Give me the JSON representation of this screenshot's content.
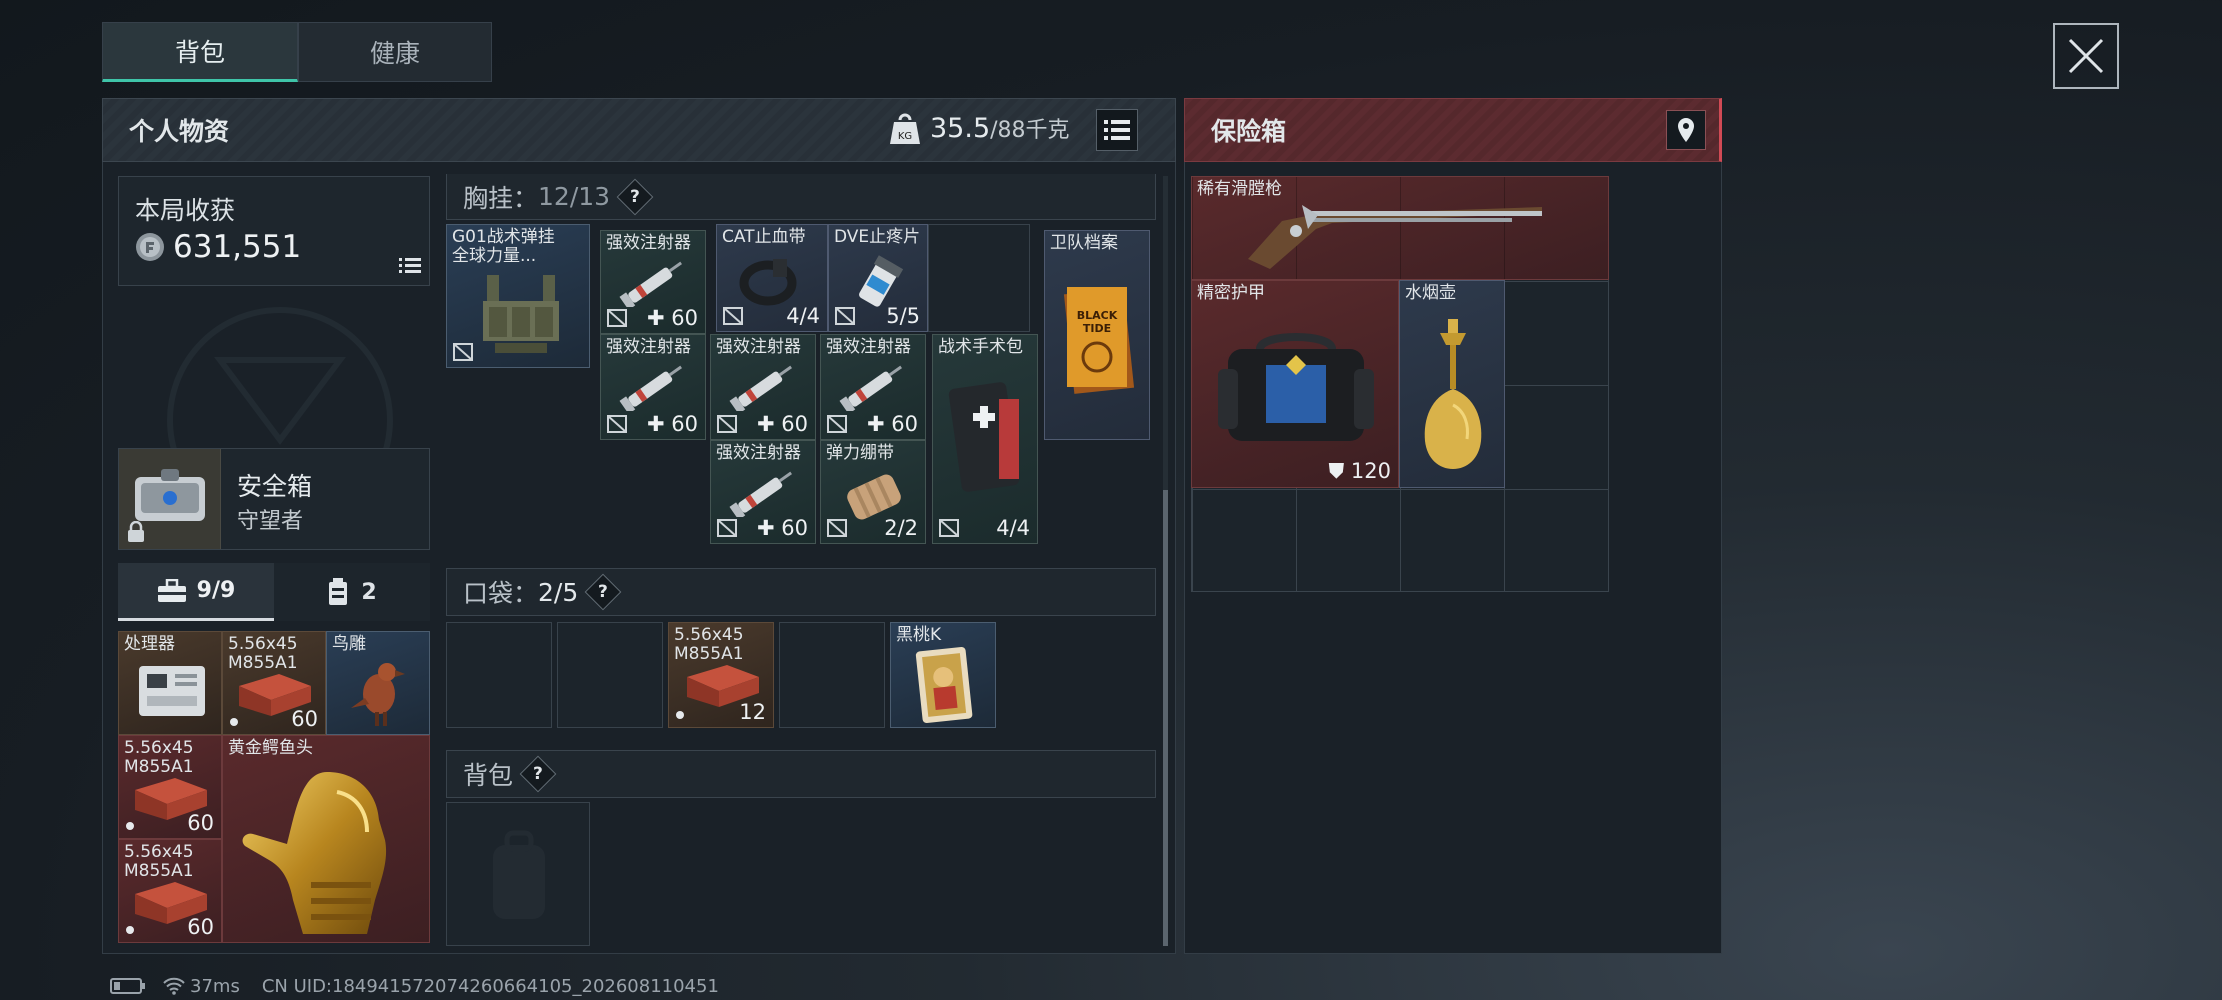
{
  "tabs": [
    {
      "label": "背包"
    },
    {
      "label": "健康"
    }
  ],
  "personal": {
    "title": "个人物资",
    "weight_current": "35.5",
    "weight_max": "/88千克"
  },
  "safebox": {
    "title": "保险箱"
  },
  "harvest": {
    "label": "本局收获",
    "value": "631,551"
  },
  "secure_case": {
    "name": "安全箱",
    "sub": "守望者"
  },
  "subtabs": [
    {
      "label": "9/9"
    },
    {
      "label": "2"
    }
  ],
  "left_items": [
    {
      "name": "处理器",
      "count": ""
    },
    {
      "name": "5.56x45\nM855A1",
      "count": "60"
    },
    {
      "name": "鸟雕",
      "count": ""
    },
    {
      "name": "5.56x45\nM855A1",
      "count": "60"
    },
    {
      "name": "黄金鳄鱼头",
      "count": ""
    },
    {
      "name": "5.56x45\nM855A1",
      "count": "60"
    }
  ],
  "chest": {
    "label": "胸挂：",
    "value": "12/13",
    "items": [
      {
        "name": "G01战术弹挂\n全球力量...",
        "count": ""
      },
      {
        "name": "强效注射器",
        "count": "60"
      },
      {
        "name": "CAT止血带",
        "count": "4/4"
      },
      {
        "name": "DVE止疼片",
        "count": "5/5"
      },
      {
        "name": "卫队档案",
        "count": ""
      },
      {
        "name": "强效注射器",
        "count": "60"
      },
      {
        "name": "强效注射器",
        "count": "60"
      },
      {
        "name": "强效注射器",
        "count": "60"
      },
      {
        "name": "战术手术包",
        "count": "4/4"
      },
      {
        "name": "强效注射器",
        "count": "60"
      },
      {
        "name": "弹力绷带",
        "count": "2/2"
      }
    ]
  },
  "pockets": {
    "label": "口袋：",
    "value": "2/5",
    "items": [
      {
        "name": "5.56x45\nM855A1",
        "count": "12"
      },
      {
        "name": "黑桃K",
        "count": ""
      }
    ]
  },
  "backpack": {
    "label": "背包"
  },
  "safe_items": [
    {
      "name": "稀有滑膛枪",
      "count": ""
    },
    {
      "name": "精密护甲",
      "count": "120"
    },
    {
      "name": "水烟壶",
      "count": ""
    }
  ],
  "status": {
    "ping": "37ms",
    "uid": "CN UID:184941572074260664105_202608110451"
  },
  "colors": {
    "accent": "#3fc5a9",
    "safe_header": "#5a2a2e",
    "panel": "#1a2128"
  }
}
